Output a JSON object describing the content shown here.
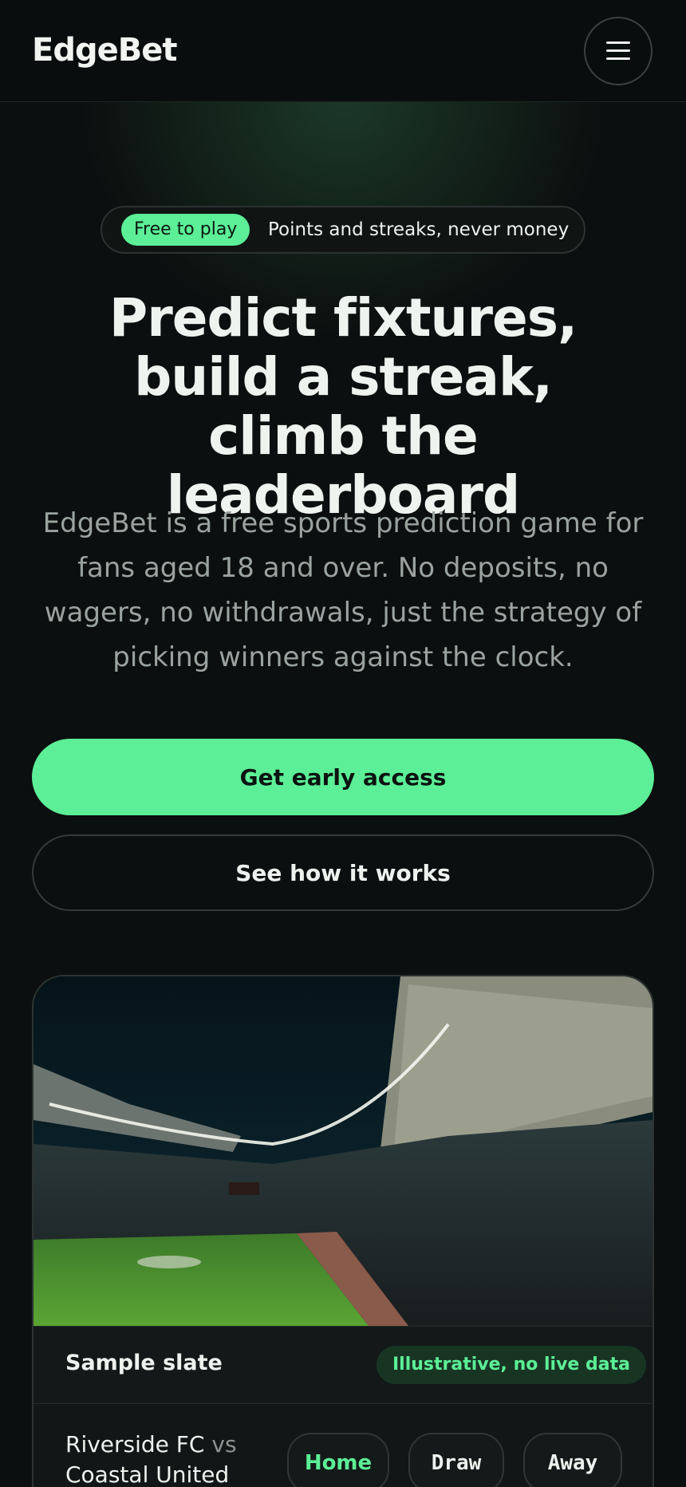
{
  "header": {
    "logo": "EdgeBet",
    "menu_icon": "hamburger-menu-icon"
  },
  "hero": {
    "badge_pill": "Free to play",
    "badge_text": "Points and streaks, never money",
    "title": "Predict fixtures, build a streak, climb the leaderboard",
    "description": "EdgeBet is a free sports prediction game for fans aged 18 and over. No deposits, no wagers, no withdrawals, just the strategy of picking winners against the clock.",
    "primary_cta": "Get early access",
    "secondary_cta": "See how it works"
  },
  "slate": {
    "title": "Sample slate",
    "tag": "Illustrative, no live data",
    "fixture": {
      "home_team": "Riverside FC",
      "separator": "vs",
      "away_team": "Coastal United"
    },
    "picks": [
      "Home",
      "Draw",
      "Away"
    ],
    "selected_pick": "Home"
  },
  "colors": {
    "background": "#0c0f0f",
    "accent": "#5cef97",
    "muted_text": "#9aa39f"
  }
}
